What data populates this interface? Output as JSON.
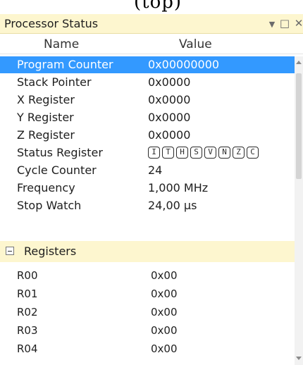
{
  "caption": "(top)",
  "panel": {
    "title": "Processor Status",
    "icons": {
      "dropdown": "dropdown-arrow-icon",
      "maximize": "maximize-icon",
      "close": "close-icon"
    }
  },
  "columns": {
    "name": "Name",
    "value": "Value"
  },
  "properties": [
    {
      "name": "Program Counter",
      "value": "0x00000000",
      "selected": true
    },
    {
      "name": "Stack Pointer",
      "value": "0x0000"
    },
    {
      "name": "X Register",
      "value": "0x0000"
    },
    {
      "name": "Y Register",
      "value": "0x0000"
    },
    {
      "name": "Z Register",
      "value": "0x0000"
    },
    {
      "name": "Status Register",
      "value": "",
      "flags": [
        "I",
        "T",
        "H",
        "S",
        "V",
        "N",
        "Z",
        "C"
      ]
    },
    {
      "name": "Cycle Counter",
      "value": "24"
    },
    {
      "name": "Frequency",
      "value": "1,000 MHz"
    },
    {
      "name": "Stop Watch",
      "value": "24,00 µs"
    }
  ],
  "registers_section": {
    "label": "Registers",
    "expanded": true
  },
  "registers": [
    {
      "name": "R00",
      "value": "0x00"
    },
    {
      "name": "R01",
      "value": "0x00"
    },
    {
      "name": "R02",
      "value": "0x00"
    },
    {
      "name": "R03",
      "value": "0x00"
    },
    {
      "name": "R04",
      "value": "0x00"
    }
  ],
  "colors": {
    "title_bar": "#fdf6cf",
    "selection": "#3399ff",
    "section_header": "#fdf6cf"
  }
}
